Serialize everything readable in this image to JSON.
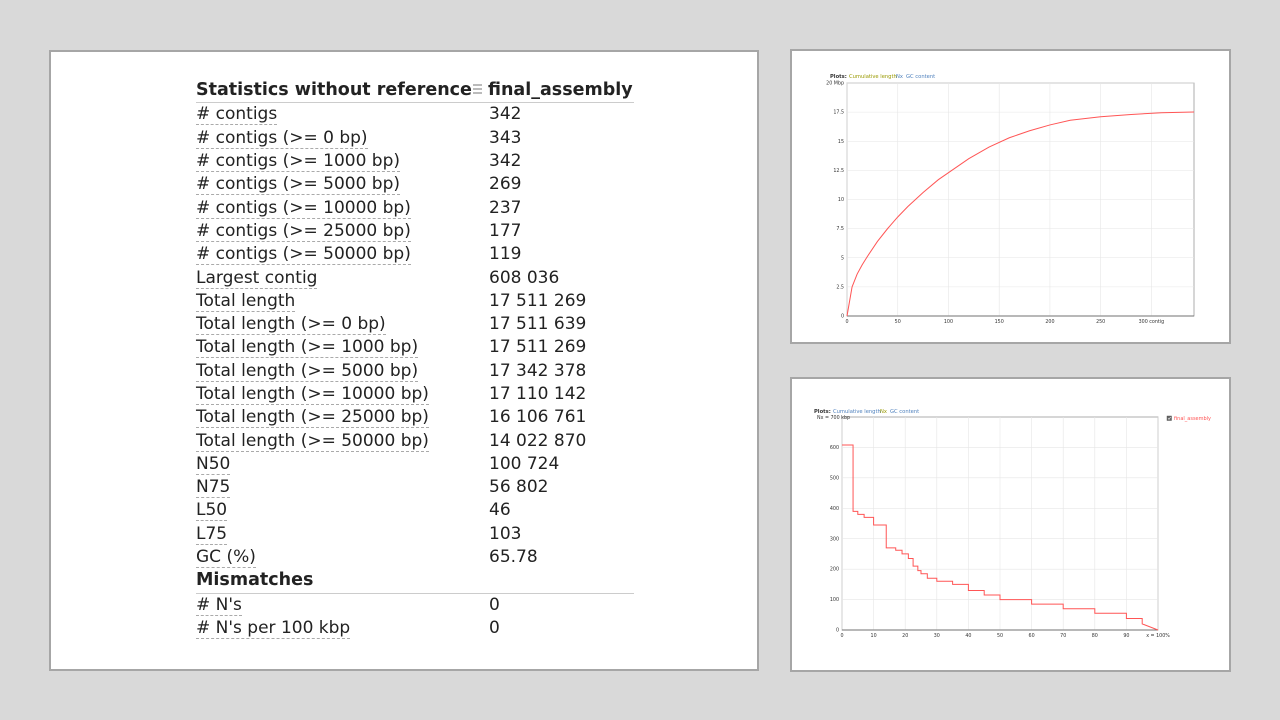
{
  "stats": {
    "header": {
      "title": "Statistics without reference",
      "assembly": "final_assembly"
    },
    "rows": [
      {
        "label": "# contigs",
        "value": "342"
      },
      {
        "label": "# contigs (>= 0 bp)",
        "value": "343"
      },
      {
        "label": "# contigs (>= 1000 bp)",
        "value": "342"
      },
      {
        "label": "# contigs (>= 5000 bp)",
        "value": "269"
      },
      {
        "label": "# contigs (>= 10000 bp)",
        "value": "237"
      },
      {
        "label": "# contigs (>= 25000 bp)",
        "value": "177"
      },
      {
        "label": "# contigs (>= 50000 bp)",
        "value": "119"
      },
      {
        "label": "Largest contig",
        "value": "608 036"
      },
      {
        "label": "Total length",
        "value": "17 511 269"
      },
      {
        "label": "Total length (>= 0 bp)",
        "value": "17 511 639"
      },
      {
        "label": "Total length (>= 1000 bp)",
        "value": "17 511 269"
      },
      {
        "label": "Total length (>= 5000 bp)",
        "value": "17 342 378"
      },
      {
        "label": "Total length (>= 10000 bp)",
        "value": "17 110 142"
      },
      {
        "label": "Total length (>= 25000 bp)",
        "value": "16 106 761"
      },
      {
        "label": "Total length (>= 50000 bp)",
        "value": "14 022 870"
      },
      {
        "label": "N50",
        "value": "100 724"
      },
      {
        "label": "N75",
        "value": "56 802"
      },
      {
        "label": "L50",
        "value": "46"
      },
      {
        "label": "L75",
        "value": "103"
      },
      {
        "label": "GC (%)",
        "value": "65.78"
      }
    ],
    "mismatches": {
      "title": "Mismatches",
      "rows": [
        {
          "label": "# N's",
          "value": "0"
        },
        {
          "label": "# N's per 100 kbp",
          "value": "0"
        }
      ]
    }
  },
  "chart_data": [
    {
      "type": "line",
      "plots_label": "Plots:",
      "tabs": [
        {
          "label": "Cumulative length",
          "color": "#999900"
        },
        {
          "label": "Nx",
          "color": "#4f81bd"
        },
        {
          "label": "GC content",
          "color": "#4f81bd"
        }
      ],
      "series": [
        {
          "color": "#ff5555",
          "x": [
            0,
            5,
            10,
            15,
            20,
            30,
            40,
            50,
            60,
            75,
            90,
            100,
            120,
            140,
            160,
            180,
            200,
            220,
            250,
            280,
            310,
            342
          ],
          "y": [
            0,
            2.5,
            3.6,
            4.4,
            5.1,
            6.4,
            7.5,
            8.5,
            9.4,
            10.6,
            11.7,
            12.3,
            13.5,
            14.5,
            15.3,
            15.9,
            16.4,
            16.8,
            17.1,
            17.3,
            17.45,
            17.51
          ]
        }
      ],
      "xlim": [
        0,
        342
      ],
      "ylim": [
        0,
        20
      ],
      "xticks": [
        "0",
        "50",
        "100",
        "150",
        "200",
        "250",
        "300 contig"
      ],
      "xtick_values": [
        0,
        50,
        100,
        150,
        200,
        250,
        300
      ],
      "yticks": [
        "0",
        "2.5",
        "5",
        "7.5",
        "10",
        "12.5",
        "15",
        "17.5",
        "20 Mbp"
      ],
      "ytick_values": [
        0,
        2.5,
        5,
        7.5,
        10,
        12.5,
        15,
        17.5,
        20
      ],
      "grid": true
    },
    {
      "type": "line",
      "plots_label": "Plots:",
      "tabs": [
        {
          "label": "Cumulative length",
          "color": "#4f81bd"
        },
        {
          "label": "Nx",
          "color": "#999900"
        },
        {
          "label": "GC content",
          "color": "#4f81bd"
        }
      ],
      "ylabel": "Nx = 700 kbp",
      "legend": {
        "label": "final_assembly",
        "color": "#ff5555",
        "checked": true
      },
      "series": [
        {
          "name": "final_assembly",
          "color": "#ff5555",
          "step": true,
          "x": [
            0,
            3.5,
            3.5,
            5,
            5,
            7,
            7,
            10,
            10,
            14,
            14,
            17,
            17,
            19,
            19,
            21,
            21,
            22.5,
            22.5,
            24,
            24,
            25,
            25,
            27,
            27,
            30,
            30,
            35,
            35,
            40,
            40,
            45,
            45,
            50,
            50,
            60,
            60,
            70,
            70,
            80,
            80,
            90,
            90,
            95,
            95,
            100
          ],
          "y": [
            608,
            608,
            390,
            390,
            380,
            380,
            370,
            370,
            345,
            345,
            270,
            270,
            262,
            262,
            250,
            250,
            235,
            235,
            210,
            210,
            195,
            195,
            185,
            185,
            170,
            170,
            160,
            160,
            150,
            150,
            130,
            130,
            115,
            115,
            100,
            100,
            85,
            85,
            70,
            70,
            55,
            55,
            38,
            38,
            20,
            0
          ]
        }
      ],
      "xlim": [
        0,
        100
      ],
      "ylim": [
        0,
        700
      ],
      "xticks": [
        "0",
        "10",
        "20",
        "30",
        "40",
        "50",
        "60",
        "70",
        "80",
        "90",
        "x = 100%"
      ],
      "xtick_values": [
        0,
        10,
        20,
        30,
        40,
        50,
        60,
        70,
        80,
        90,
        100
      ],
      "yticks": [
        "0",
        "100",
        "200",
        "300",
        "400",
        "500",
        "600"
      ],
      "ytick_values": [
        0,
        100,
        200,
        300,
        400,
        500,
        600
      ],
      "grid": true
    }
  ]
}
